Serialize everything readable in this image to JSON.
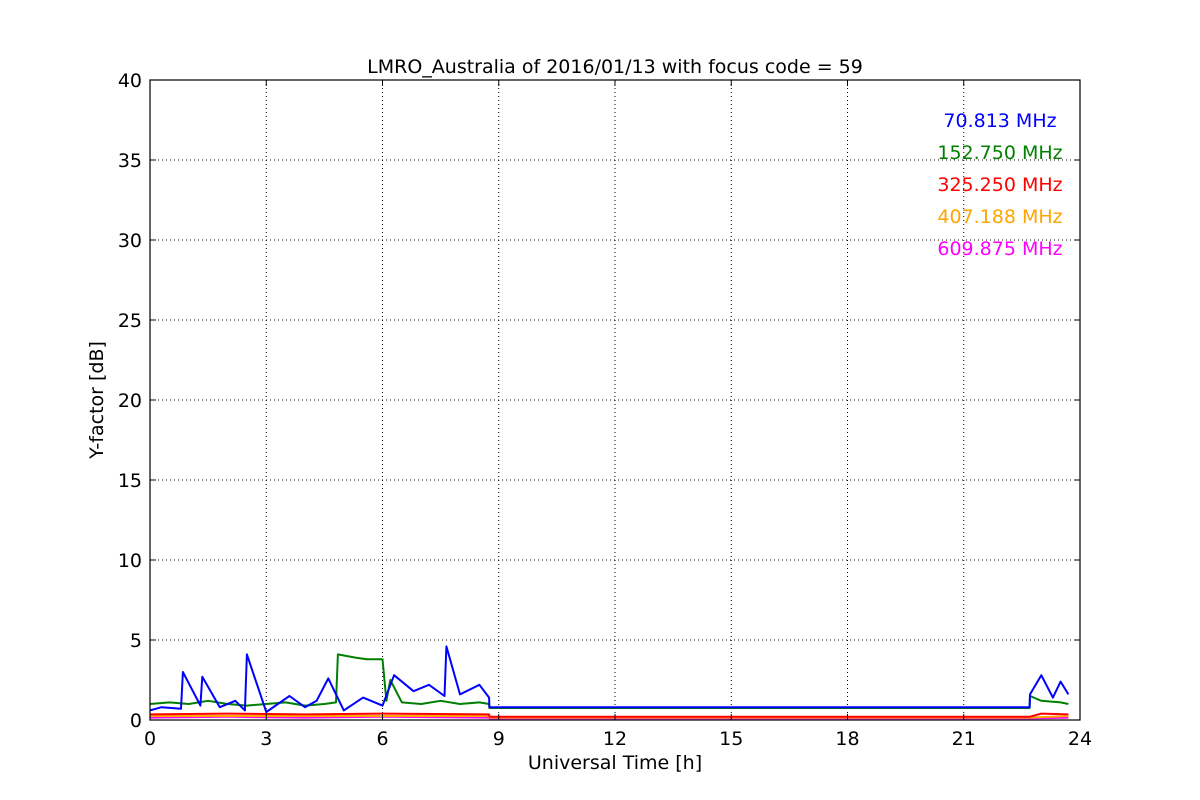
{
  "chart_data": {
    "type": "line",
    "title": "LMRO_Australia of 2016/01/13 with focus code = 59",
    "xlabel": "Universal Time [h]",
    "ylabel": "Y-factor [dB]",
    "xlim": [
      0,
      24
    ],
    "ylim": [
      0,
      40
    ],
    "xticks": [
      0,
      3,
      6,
      9,
      12,
      15,
      18,
      21,
      24
    ],
    "yticks": [
      0,
      5,
      10,
      15,
      20,
      25,
      30,
      35,
      40
    ],
    "grid": true,
    "legend_position": "top-right",
    "series": [
      {
        "name": "70.813 MHz",
        "color": "#0000ff",
        "x": [
          0.0,
          0.3,
          0.8,
          0.85,
          1.3,
          1.35,
          1.8,
          2.2,
          2.45,
          2.5,
          3.0,
          3.6,
          4.0,
          4.3,
          4.6,
          5.0,
          5.5,
          6.0,
          6.3,
          6.8,
          7.2,
          7.6,
          7.65,
          8.0,
          8.5,
          8.75,
          8.76,
          22.7,
          22.71,
          23.0,
          23.3,
          23.5,
          23.7
        ],
        "y": [
          0.6,
          0.8,
          0.7,
          3.0,
          0.9,
          2.7,
          0.8,
          1.2,
          0.6,
          4.1,
          0.5,
          1.5,
          0.8,
          1.2,
          2.6,
          0.6,
          1.4,
          0.9,
          2.8,
          1.8,
          2.2,
          1.5,
          4.6,
          1.6,
          2.2,
          1.4,
          0.8,
          0.8,
          1.6,
          2.8,
          1.4,
          2.4,
          1.6
        ]
      },
      {
        "name": "152.750 MHz",
        "color": "#008000",
        "x": [
          0.0,
          0.5,
          1.0,
          1.5,
          2.0,
          2.5,
          3.0,
          3.5,
          4.0,
          4.5,
          4.8,
          4.85,
          5.3,
          5.6,
          6.0,
          6.1,
          6.2,
          6.5,
          7.0,
          7.5,
          8.0,
          8.5,
          8.75,
          8.76,
          22.7,
          22.71,
          23.0,
          23.5,
          23.7
        ],
        "y": [
          1.0,
          1.1,
          1.0,
          1.2,
          1.0,
          0.9,
          1.0,
          1.1,
          0.9,
          1.0,
          1.1,
          4.1,
          3.9,
          3.8,
          3.8,
          1.2,
          2.5,
          1.1,
          1.0,
          1.2,
          1.0,
          1.1,
          1.0,
          0.75,
          0.75,
          1.5,
          1.2,
          1.1,
          1.0
        ]
      },
      {
        "name": "325.250 MHz",
        "color": "#ff0000",
        "x": [
          0.0,
          2.0,
          4.0,
          6.0,
          8.75,
          8.76,
          22.7,
          23.0,
          23.7
        ],
        "y": [
          0.35,
          0.4,
          0.35,
          0.4,
          0.35,
          0.2,
          0.2,
          0.4,
          0.35
        ]
      },
      {
        "name": "407.188 MHz",
        "color": "#ffa500",
        "x": [
          0.0,
          3.0,
          6.0,
          8.75,
          8.76,
          22.7,
          23.7
        ],
        "y": [
          0.25,
          0.25,
          0.25,
          0.25,
          0.15,
          0.15,
          0.25
        ]
      },
      {
        "name": "609.875 MHz",
        "color": "#ff00ff",
        "x": [
          0.0,
          2.0,
          4.0,
          6.0,
          8.75,
          8.76,
          22.7,
          23.7
        ],
        "y": [
          0.15,
          0.2,
          0.15,
          0.2,
          0.15,
          0.1,
          0.1,
          0.15
        ]
      }
    ]
  }
}
